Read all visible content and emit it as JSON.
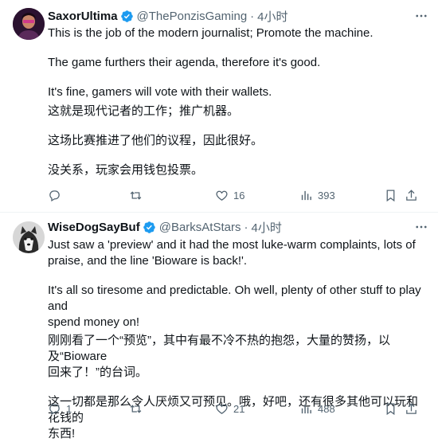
{
  "tweets": [
    {
      "name": "SaxorUltima",
      "handle": "@ThePonzisGaming",
      "dot": "·",
      "time": "4小时",
      "more_icon": "more-horizontal-icon",
      "lines": [
        "This is the job of the modern journalist; Promote the machine.",
        "The game furthers their agenda, therefore it's good.",
        "It's fine, gamers will vote with their wallets.",
        "这就是现代记者的工作；推广机器。",
        "这场比赛推进了他们的议程，因此很好。",
        "没关系，玩家会用钱包投票。"
      ],
      "replies": "",
      "retweets": "",
      "likes": "16",
      "views": "393"
    },
    {
      "name": "WiseDogSayBuf",
      "handle": "@BarksAtStars",
      "dot": "·",
      "time": "4小时",
      "more_icon": "more-horizontal-icon",
      "lines": [
        "Just saw a 'preview' and it had the most luke-warm complaints, lots of",
        "praise, and the line 'Bioware is back!'.",
        "It's all so tiresome and predictable. Oh well, plenty of other stuff to play and",
        "spend money on!",
        "刚刚看了一个“预览”，其中有最不冷不热的抱怨，大量的赞扬，以及“Bioware",
        "回来了！”的台词。",
        "这一切都是那么令人厌烦又可预见。哦，好吧，还有很多其他可以玩和花钱的",
        "东西!"
      ],
      "replies": "1",
      "retweets": "",
      "likes": "21",
      "views": "488"
    }
  ],
  "colors": {
    "verified": "#1d9bf0",
    "secondary_text": "#536471",
    "divider": "#eff3f4"
  }
}
